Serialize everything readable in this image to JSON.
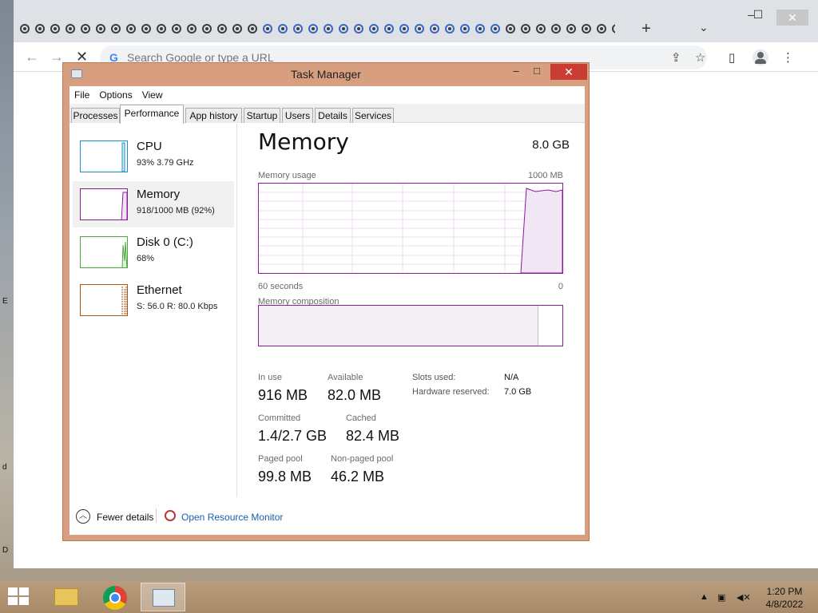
{
  "browser": {
    "tab_count_icons": 40,
    "new_tab_label": "+",
    "tab_search_icon": "chevron-down-icon",
    "window_controls": {
      "minimize": "–",
      "maximize": "☐",
      "close": "✕"
    },
    "omnibox": {
      "placeholder": "Search Google or type a URL",
      "value": ""
    }
  },
  "task_manager": {
    "title": "Task Manager",
    "menu": [
      "File",
      "Options",
      "View"
    ],
    "tabs": [
      "Processes",
      "Performance",
      "App history",
      "Startup",
      "Users",
      "Details",
      "Services"
    ],
    "active_tab": "Performance",
    "sidebar": [
      {
        "name": "CPU",
        "detail": "93%  3.79 GHz",
        "color": "#1b8fc9"
      },
      {
        "name": "Memory",
        "detail": "918/1000 MB (92%)",
        "color": "#8b1a9b"
      },
      {
        "name": "Disk 0 (C:)",
        "detail": "68%",
        "color": "#4da73f"
      },
      {
        "name": "Ethernet",
        "detail": "S: 56.0  R: 80.0 Kbps",
        "color": "#a7571a"
      }
    ],
    "memory": {
      "title": "Memory",
      "total": "8.0 GB",
      "usage_label": "Memory usage",
      "usage_max": "1000 MB",
      "time_span": "60 seconds",
      "time_end": "0",
      "composition_label": "Memory composition",
      "in_use_fraction": 0.92,
      "stats": {
        "in_use_label": "In use",
        "in_use": "916 MB",
        "available_label": "Available",
        "available": "82.0 MB",
        "committed_label": "Committed",
        "committed": "1.4/2.7 GB",
        "cached_label": "Cached",
        "cached": "82.4 MB",
        "paged_pool_label": "Paged pool",
        "paged_pool": "99.8 MB",
        "non_paged_pool_label": "Non-paged pool",
        "non_paged_pool": "46.2 MB",
        "slots_used_label": "Slots used:",
        "slots_used": "N/A",
        "hw_reserved_label": "Hardware reserved:",
        "hw_reserved": "7.0 GB"
      }
    },
    "footer": {
      "fewer_details": "Fewer details",
      "open_resource_monitor": "Open Resource Monitor"
    }
  },
  "desktop": {
    "edge_letters": [
      "E",
      "d",
      "D"
    ]
  },
  "taskbar": {
    "clock_time": "1:20 PM",
    "clock_date": "4/8/2022"
  }
}
